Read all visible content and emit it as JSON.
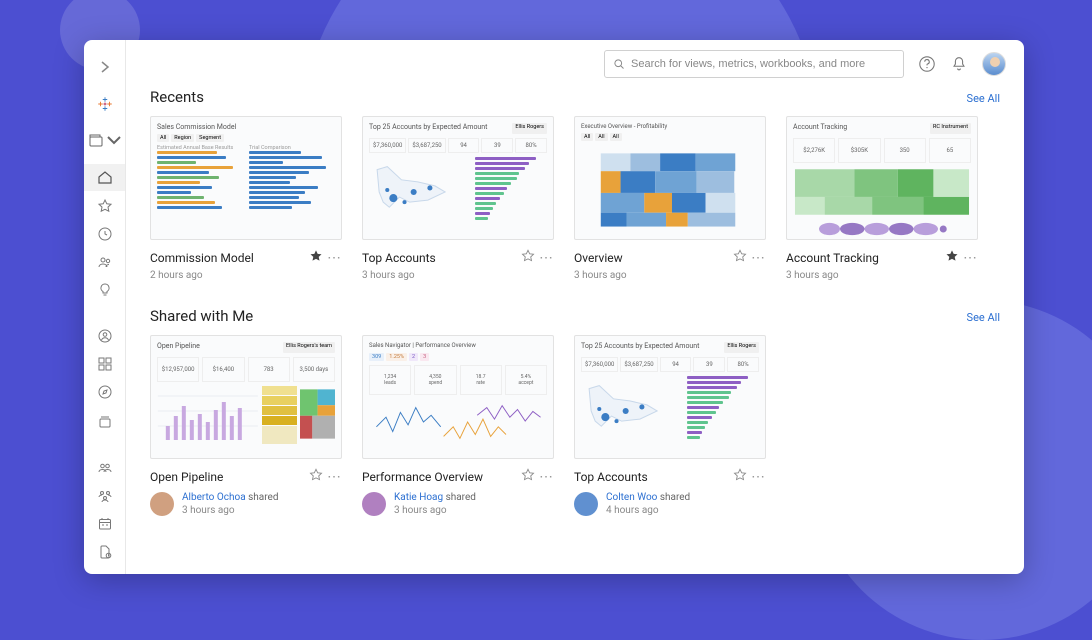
{
  "topbar": {
    "search_placeholder": "Search for views, metrics, workbooks, and more"
  },
  "sections": {
    "recents": {
      "title": "Recents",
      "see_all": "See All"
    },
    "shared": {
      "title": "Shared with Me",
      "see_all": "See All"
    }
  },
  "recents": [
    {
      "title": "Commission Model",
      "time": "2 hours ago",
      "thumb_title": "Sales Commission Model",
      "favorite": true
    },
    {
      "title": "Top Accounts",
      "time": "3 hours ago",
      "thumb_title": "Top 25 Accounts by Expected Amount",
      "favorite": false
    },
    {
      "title": "Overview",
      "time": "3 hours ago",
      "thumb_title": "Executive Overview - Profitability",
      "favorite": false
    },
    {
      "title": "Account Tracking",
      "time": "3 hours ago",
      "thumb_title": "Account Tracking",
      "favorite": true
    }
  ],
  "shared": [
    {
      "title": "Open Pipeline",
      "thumb_title": "Open Pipeline",
      "favorite": false,
      "shared_by": "Alberto Ochoa",
      "shared_label": "shared",
      "time": "3 hours ago"
    },
    {
      "title": "Performance Overview",
      "thumb_title": "Sales Navigator | Performance Overview",
      "favorite": false,
      "shared_by": "Katie Hoag",
      "shared_label": "shared",
      "time": "3 hours ago"
    },
    {
      "title": "Top Accounts",
      "thumb_title": "Top 25 Accounts by Expected Amount",
      "favorite": false,
      "shared_by": "Colten Woo",
      "shared_label": "shared",
      "time": "4 hours ago"
    }
  ]
}
